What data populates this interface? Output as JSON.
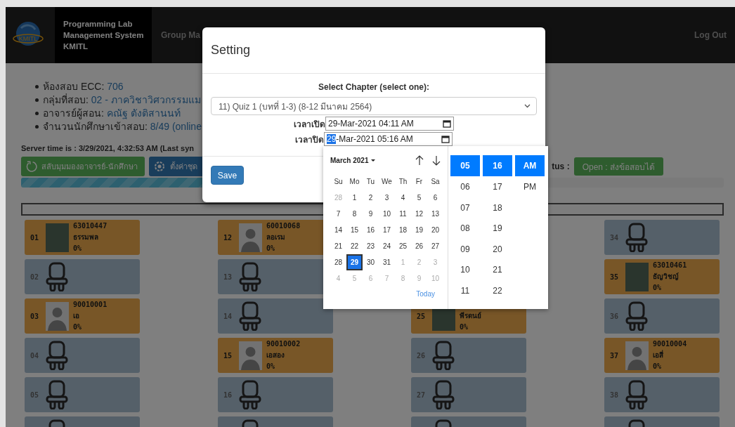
{
  "navbar": {
    "logo_text": "KMITL",
    "brand": [
      "Programming Lab",
      "Management System",
      "KMITL"
    ],
    "links": [
      "Group Ma"
    ],
    "logout": "Log Out"
  },
  "info": [
    {
      "label": "ห้องสอบ ECC:",
      "value": "706"
    },
    {
      "label": "กลุ่มที่สอบ:",
      "value": "02 - ภาควิชาวิศวกรรมแม"
    },
    {
      "label": "อาจารย์ผู้สอน:",
      "value": "คณัฐ ตังติสานนท์"
    },
    {
      "label": "จำนวนนักศึกษาเข้าสอบ:",
      "value": "8/49 (online"
    }
  ],
  "server_time": "Server time is : 3/29/2021, 4:32:53 AM (Last syn",
  "actions": [
    {
      "label": "สลับมุมมองอาจารย์-นักศึกษา",
      "kind": "refresh"
    },
    {
      "label": "ตั้งค่าชุด",
      "kind": "settings"
    }
  ],
  "status": {
    "label": "tus :",
    "badge": "Open : ส่งข้อสอบได้"
  },
  "progress": {
    "level": 0.45
  },
  "seat_columns": [
    [
      {
        "kind": "occupied",
        "number": "01",
        "student_id": "63010447",
        "name": "ธรรมพล",
        "progress": "0%",
        "picture": {
          "kind": "photo"
        }
      },
      {
        "kind": "empty",
        "number": "02"
      },
      {
        "kind": "occupied",
        "number": "03",
        "student_id": "90010001",
        "name": "เอ",
        "progress": "0%",
        "picture": {
          "kind": "avatar"
        }
      },
      {
        "kind": "empty",
        "number": "04"
      },
      {
        "kind": "empty",
        "number": "05"
      },
      {
        "kind": "empty"
      }
    ],
    [
      {
        "kind": "occupied",
        "number": "12",
        "student_id": "60010068",
        "name": "ลอเรม",
        "progress": "0%",
        "picture": {
          "kind": "avatar"
        }
      },
      {
        "kind": "empty",
        "number": "13"
      },
      {
        "kind": "empty",
        "number": "14"
      },
      {
        "kind": "occupied",
        "number": "15",
        "student_id": "90010002",
        "name": "เอสอง",
        "progress": "0%",
        "picture": {
          "kind": "avatar"
        }
      },
      {
        "kind": "empty",
        "number": "16"
      },
      {
        "kind": "empty"
      }
    ],
    [
      {
        "kind": "occupied",
        "number": "25",
        "name": "พีรดนย์",
        "progress": "0%",
        "picture": {
          "kind": "photo"
        }
      },
      {
        "kind": "empty",
        "number": "26"
      },
      {
        "kind": "empty",
        "number": "27"
      },
      {
        "kind": "empty"
      }
    ],
    [
      {
        "kind": "empty",
        "number": "34"
      },
      {
        "kind": "occupied",
        "number": "35",
        "student_id": "63010461",
        "name": "ธัญวิชญ์",
        "progress": "0%",
        "picture": {
          "kind": "photo"
        }
      },
      {
        "kind": "empty",
        "number": "36"
      },
      {
        "kind": "occupied",
        "number": "37",
        "student_id": "90010004",
        "name": "เอสี่",
        "progress": "0%",
        "picture": {
          "kind": "avatar"
        }
      },
      {
        "kind": "empty",
        "number": "38"
      },
      {
        "kind": "empty"
      }
    ]
  ],
  "modal": {
    "title": "Setting",
    "chapter_label": "Select Chapter (select one):",
    "chapter": "11) Quiz 1 (บทที่ 1-3) (8-12 มีนาคม 2564)",
    "times": [
      {
        "label": "เวลาเปิด",
        "segments": [
          {
            "text": "29-Mar-2021 04:11 AM",
            "selected": false
          }
        ]
      },
      {
        "label": "เวลาปิด",
        "segments": [
          {
            "text": "29",
            "selected": true
          },
          {
            "text": "-Mar-2021 05:16 AM",
            "selected": false
          }
        ]
      }
    ],
    "save": "Save"
  },
  "datepicker": {
    "month": "March 2021",
    "weekdays": [
      "Su",
      "Mo",
      "Tu",
      "We",
      "Th",
      "Fr",
      "Sa"
    ],
    "days": [
      {
        "day": "28",
        "muted": true,
        "selected": false
      },
      {
        "day": "1",
        "muted": false,
        "selected": false
      },
      {
        "day": "2",
        "muted": false,
        "selected": false
      },
      {
        "day": "3",
        "muted": false,
        "selected": false
      },
      {
        "day": "4",
        "muted": false,
        "selected": false
      },
      {
        "day": "5",
        "muted": false,
        "selected": false
      },
      {
        "day": "6",
        "muted": false,
        "selected": false
      },
      {
        "day": "7",
        "muted": false,
        "selected": false
      },
      {
        "day": "8",
        "muted": false,
        "selected": false
      },
      {
        "day": "9",
        "muted": false,
        "selected": false
      },
      {
        "day": "10",
        "muted": false,
        "selected": false
      },
      {
        "day": "11",
        "muted": false,
        "selected": false
      },
      {
        "day": "12",
        "muted": false,
        "selected": false
      },
      {
        "day": "13",
        "muted": false,
        "selected": false
      },
      {
        "day": "14",
        "muted": false,
        "selected": false
      },
      {
        "day": "15",
        "muted": false,
        "selected": false
      },
      {
        "day": "16",
        "muted": false,
        "selected": false
      },
      {
        "day": "17",
        "muted": false,
        "selected": false
      },
      {
        "day": "18",
        "muted": false,
        "selected": false
      },
      {
        "day": "19",
        "muted": false,
        "selected": false
      },
      {
        "day": "20",
        "muted": false,
        "selected": false
      },
      {
        "day": "21",
        "muted": false,
        "selected": false
      },
      {
        "day": "22",
        "muted": false,
        "selected": false
      },
      {
        "day": "23",
        "muted": false,
        "selected": false
      },
      {
        "day": "24",
        "muted": false,
        "selected": false
      },
      {
        "day": "25",
        "muted": false,
        "selected": false
      },
      {
        "day": "26",
        "muted": false,
        "selected": false
      },
      {
        "day": "27",
        "muted": false,
        "selected": false
      },
      {
        "day": "28",
        "muted": false,
        "selected": false
      },
      {
        "day": "29",
        "muted": false,
        "selected": true
      },
      {
        "day": "30",
        "muted": false,
        "selected": false
      },
      {
        "day": "31",
        "muted": false,
        "selected": false
      },
      {
        "day": "1",
        "muted": true,
        "selected": false
      },
      {
        "day": "2",
        "muted": true,
        "selected": false
      },
      {
        "day": "3",
        "muted": true,
        "selected": false
      },
      {
        "day": "4",
        "muted": true,
        "selected": false
      },
      {
        "day": "5",
        "muted": true,
        "selected": false
      },
      {
        "day": "6",
        "muted": true,
        "selected": false
      },
      {
        "day": "7",
        "muted": true,
        "selected": false
      },
      {
        "day": "8",
        "muted": true,
        "selected": false
      },
      {
        "day": "9",
        "muted": true,
        "selected": false
      },
      {
        "day": "10",
        "muted": true,
        "selected": false
      }
    ],
    "today": "Today",
    "time_columns": [
      [
        {
          "text": "05",
          "selected": true
        },
        {
          "text": "06",
          "selected": false
        },
        {
          "text": "07",
          "selected": false
        },
        {
          "text": "08",
          "selected": false
        },
        {
          "text": "09",
          "selected": false
        },
        {
          "text": "10",
          "selected": false
        },
        {
          "text": "11",
          "selected": false
        }
      ],
      [
        {
          "text": "16",
          "selected": true
        },
        {
          "text": "17",
          "selected": false
        },
        {
          "text": "18",
          "selected": false
        },
        {
          "text": "19",
          "selected": false
        },
        {
          "text": "20",
          "selected": false
        },
        {
          "text": "21",
          "selected": false
        },
        {
          "text": "22",
          "selected": false
        }
      ],
      [
        {
          "text": "AM",
          "selected": true
        },
        {
          "text": "PM",
          "selected": false
        }
      ]
    ]
  }
}
